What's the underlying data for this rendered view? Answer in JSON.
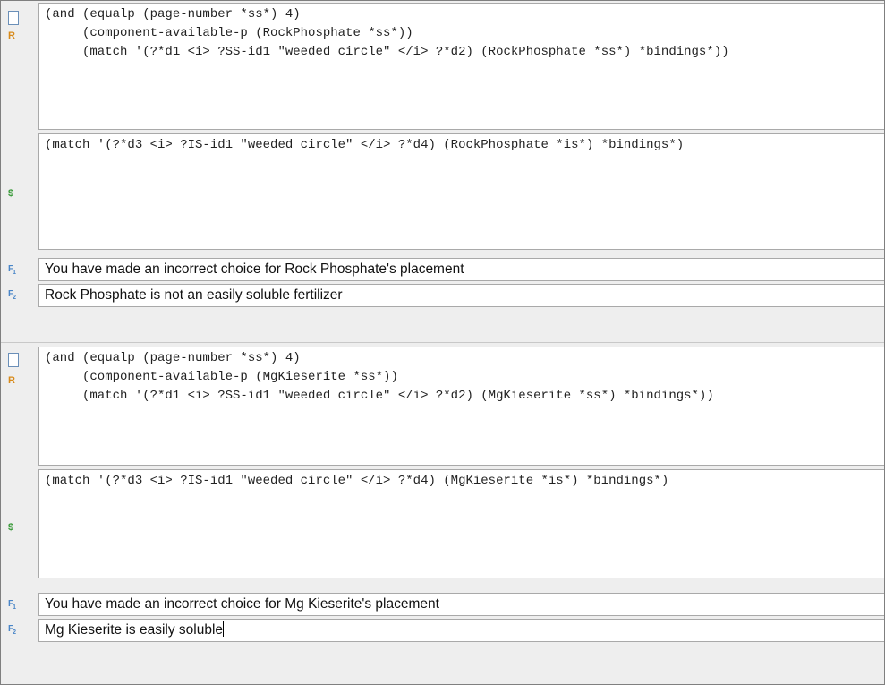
{
  "rules": [
    {
      "condition_lines": [
        "(and (equalp (page-number *ss*) 4)",
        "     (component-available-p (RockPhosphate *ss*))",
        "     (match '(?*d1 <i> ?SS-id1 \"weeded circle\" </i> ?*d2) (RockPhosphate *ss*) *bindings*))"
      ],
      "action_line": "(match '(?*d3 <i> ?IS-id1 \"weeded circle\" </i> ?*d4) (RockPhosphate *is*) *bindings*)",
      "feedback1": "You have made an incorrect choice for Rock Phosphate's placement",
      "feedback2": "Rock Phosphate is not an easily soluble fertilizer"
    },
    {
      "condition_lines": [
        "(and (equalp (page-number *ss*) 4)",
        "     (component-available-p (MgKieserite *ss*))",
        "     (match '(?*d1 <i> ?SS-id1 \"weeded circle\" </i> ?*d2) (MgKieserite *ss*) *bindings*))"
      ],
      "action_line": "(match '(?*d3 <i> ?IS-id1 \"weeded circle\" </i> ?*d4) (MgKieserite *is*) *bindings*)",
      "feedback1": "You have made an incorrect choice for Mg Kieserite's placement",
      "feedback2": "Mg Kieserite is easily soluble"
    }
  ],
  "markers": {
    "rule": "R",
    "action": "$",
    "feedback1": "F",
    "feedback1_sub": "1",
    "feedback2": "F",
    "feedback2_sub": "2"
  },
  "colors": {
    "rule_marker": "#d88a1a",
    "action_marker": "#3a9a3a",
    "feedback_marker": "#4a86c8",
    "panel_bg": "#eeeeee"
  }
}
